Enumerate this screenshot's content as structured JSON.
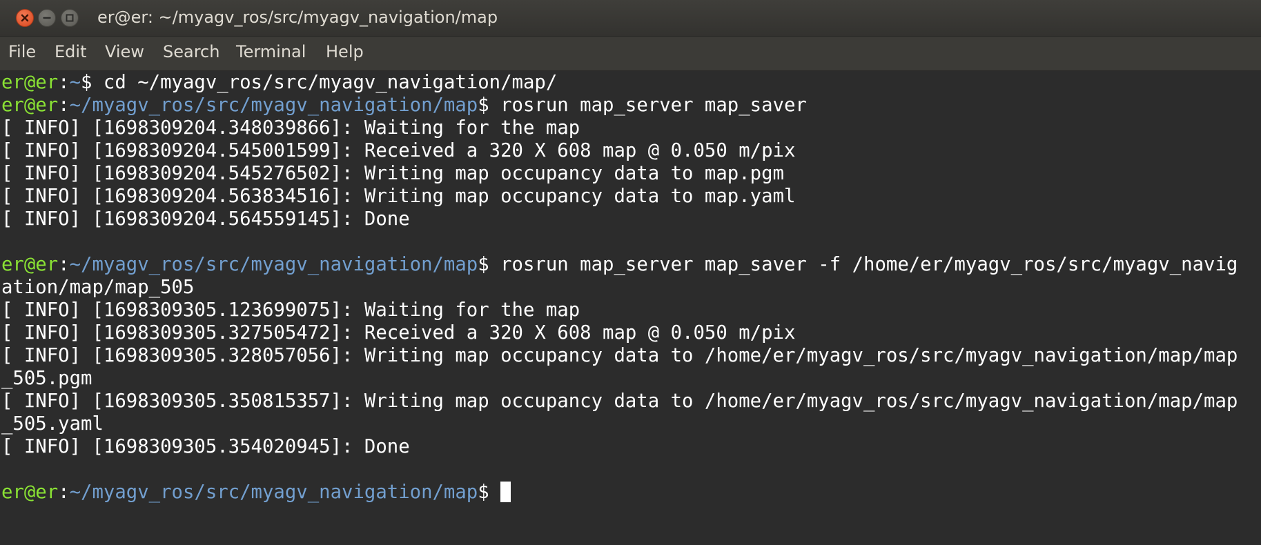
{
  "window": {
    "title": "er@er: ~/myagv_ros/src/myagv_navigation/map"
  },
  "menu": {
    "file": "File",
    "edit": "Edit",
    "view": "View",
    "search": "Search",
    "terminal": "Terminal",
    "help": "Help"
  },
  "terminal": {
    "lines": [
      {
        "user": "er@er",
        "sep": ":",
        "path": "~",
        "dollar": "$",
        "cmd": " cd ~/myagv_ros/src/myagv_navigation/map/"
      },
      {
        "user": "er@er",
        "sep": ":",
        "path": "~/myagv_ros/src/myagv_navigation/map",
        "dollar": "$",
        "cmd": " rosrun map_server map_saver"
      },
      {
        "text": "[ INFO] [1698309204.348039866]: Waiting for the map"
      },
      {
        "text": "[ INFO] [1698309204.545001599]: Received a 320 X 608 map @ 0.050 m/pix"
      },
      {
        "text": "[ INFO] [1698309204.545276502]: Writing map occupancy data to map.pgm"
      },
      {
        "text": "[ INFO] [1698309204.563834516]: Writing map occupancy data to map.yaml"
      },
      {
        "text": "[ INFO] [1698309204.564559145]: Done"
      },
      {
        "text": ""
      },
      {
        "user": "er@er",
        "sep": ":",
        "path": "~/myagv_ros/src/myagv_navigation/map",
        "dollar": "$",
        "cmd": " rosrun map_server map_saver -f /home/er/myagv_ros/src/myagv_navig"
      },
      {
        "text": "ation/map/map_505"
      },
      {
        "text": "[ INFO] [1698309305.123699075]: Waiting for the map"
      },
      {
        "text": "[ INFO] [1698309305.327505472]: Received a 320 X 608 map @ 0.050 m/pix"
      },
      {
        "text": "[ INFO] [1698309305.328057056]: Writing map occupancy data to /home/er/myagv_ros/src/myagv_navigation/map/map"
      },
      {
        "text": "_505.pgm"
      },
      {
        "text": "[ INFO] [1698309305.350815357]: Writing map occupancy data to /home/er/myagv_ros/src/myagv_navigation/map/map"
      },
      {
        "text": "_505.yaml"
      },
      {
        "text": "[ INFO] [1698309305.354020945]: Done"
      },
      {
        "text": ""
      },
      {
        "user": "er@er",
        "sep": ":",
        "path": "~/myagv_ros/src/myagv_navigation/map",
        "dollar": "$",
        "cmd": " "
      }
    ]
  },
  "icons": {
    "close": "close-icon",
    "minimize": "minimize-icon",
    "maximize": "maximize-icon"
  },
  "colors": {
    "background": "#2c2c2c",
    "prompt_user": "#8ae234",
    "prompt_path": "#729fcf",
    "text": "#ffffff",
    "close_button": "#e95420"
  }
}
